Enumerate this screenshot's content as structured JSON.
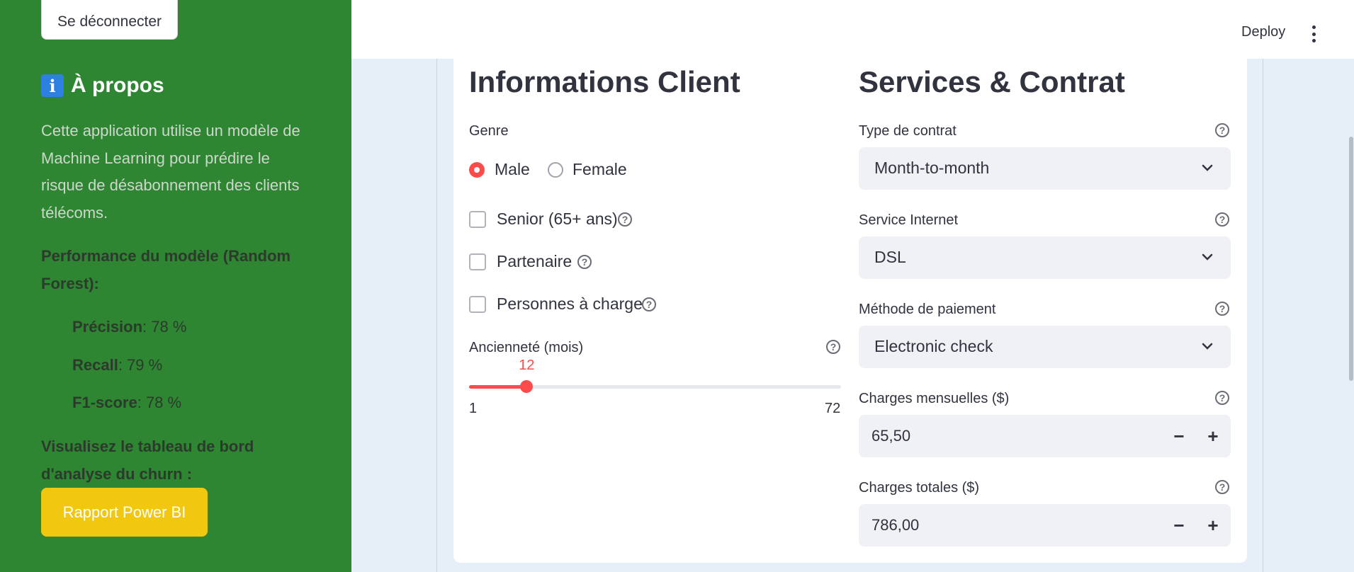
{
  "sidebar": {
    "logout_label": "Se déconnecter",
    "about_icon": "i",
    "about_title": "À propos",
    "about_text": "Cette application utilise un modèle de Machine Learning pour prédire le risque de désabonnement des clients télécoms.",
    "performance_title": "Performance du modèle (Random Forest):",
    "metrics": [
      {
        "name": "Précision",
        "value": ": 78 %"
      },
      {
        "name": "Recall",
        "value": ": 79 %"
      },
      {
        "name": "F1-score",
        "value": ": 78 %"
      }
    ],
    "dashboard_title": "Visualisez le tableau de bord d'analyse du churn :",
    "powerbi_button": "Rapport Power BI"
  },
  "header": {
    "deploy_label": "Deploy"
  },
  "client": {
    "title": "Informations Client",
    "gender_label": "Genre",
    "gender_options": [
      "Male",
      "Female"
    ],
    "gender_selected": "Male",
    "senior_label": "Senior (65+ ans)",
    "partner_label": "Partenaire",
    "dependents_label": "Personnes à charge",
    "tenure_label": "Ancienneté (mois)",
    "tenure_value": "12",
    "tenure_min": "1",
    "tenure_max": "72",
    "tenure_fraction": 0.1549
  },
  "services": {
    "title": "Services & Contrat",
    "contract_label": "Type de contrat",
    "contract_value": "Month-to-month",
    "internet_label": "Service Internet",
    "internet_value": "DSL",
    "payment_label": "Méthode de paiement",
    "payment_value": "Electronic check",
    "monthly_label": "Charges mensuelles ($)",
    "monthly_value": "65,50",
    "total_label": "Charges totales ($)",
    "total_value": "786,00",
    "minus": "−",
    "plus": "+"
  },
  "colors": {
    "sidebar_bg": "#2e8532",
    "accent": "#ff4b4b",
    "powerbi_button": "#f1c70f",
    "main_bg": "#e6eef8"
  },
  "icons": [
    "info-icon",
    "help-icon",
    "chevron-down-icon",
    "kebab-menu-icon"
  ]
}
